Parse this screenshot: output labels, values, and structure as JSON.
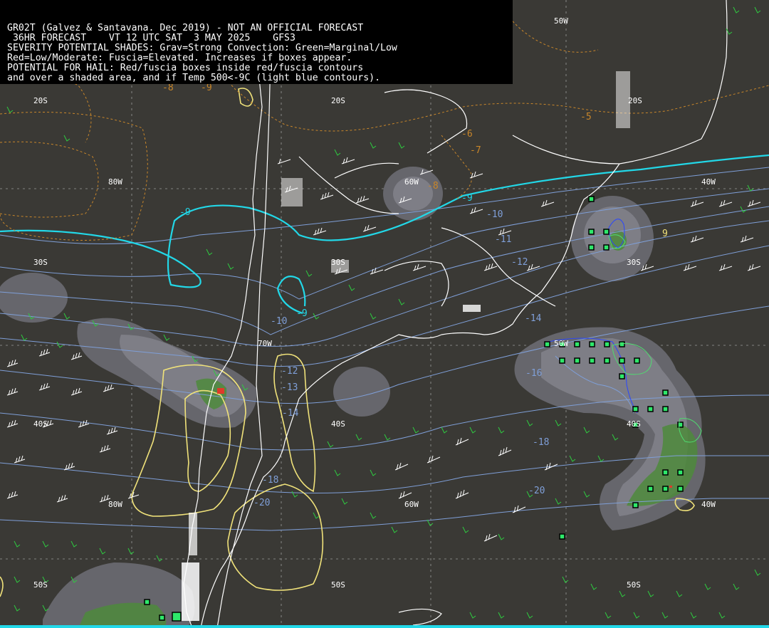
{
  "header": {
    "line1": "GR02T (Galvez & Santavana. Dec 2019) - NOT AN OFFICIAL FORECAST",
    "line2": " 36HR FORECAST    VT 12 UTC SAT  3 MAY 2025    GFS3",
    "line3": "SEVERITY POTENTIAL SHADES: Grav=Strong Convection: Green=Marginal/Low",
    "line4": "Red=Low/Moderate: Fuscia=Elevated. Increases if boxes appear.",
    "line5": "POTENTIAL FOR HAIL: Red/fuscia boxes inside red/fuscia contours",
    "line6": "and over a shaded area, and if Temp 500<-9C (light blue contours)."
  },
  "grid_labels": {
    "lon_50w_top": "50W",
    "lat_20s_a": "20S",
    "lat_20s_b": "20S",
    "lat_20s_c": "20S",
    "lon_80w_a": "80W",
    "lon_60w_a": "60W",
    "lon_40w_a": "40W",
    "lat_30s_a": "30S",
    "lat_30s_b": "30S",
    "lat_30s_c": "30S",
    "lon_70w": "70W",
    "lon_50w_mid": "50W",
    "lat_40s_a": "40S",
    "lat_40s_b": "40S",
    "lat_40s_c": "40S",
    "lon_80w_b": "80W",
    "lon_60w_b": "60W",
    "lon_40w_b": "40W",
    "lat_50s_a": "50S",
    "lat_50s_b": "50S",
    "lat_50s_c": "50S"
  },
  "contour_labels": {
    "temp_m9_a": "-9",
    "temp_m9_b": "-9",
    "temp_m9_c": "-9",
    "temp_m10_a": "-10",
    "temp_m10_b": "-10",
    "temp_m11": "-11",
    "temp_m12_a": "-12",
    "temp_m12_b": "-12",
    "temp_m13": "-13",
    "temp_m14_a": "-14",
    "temp_m14_b": "-14",
    "temp_m16": "-16",
    "temp_m18_a": "-18",
    "temp_m18_b": "-18",
    "temp_m20_a": "-20",
    "temp_m20_b": "-20",
    "orange_m5": "-5",
    "orange_m6": "-6",
    "orange_m7": "-7",
    "orange_m8_a": "-8",
    "orange_m8_b": "-8",
    "orange_m9": "-9",
    "yellow_9": "9"
  },
  "colors": {
    "background": "#3a3935",
    "coastline": "#ffffff",
    "cold_contour": "#22d8e8",
    "temp_contour": "#7f9fd8",
    "orange_dashed": "#c8862a",
    "yellow_contour": "#f0e27a",
    "gray_shade": "#6b6b71",
    "green_shade": "#4e8a3c",
    "box_fill": "#2ee86a",
    "wind_green": "#2ecc40",
    "wind_white": "#ffffff",
    "header_bg": "#000000"
  }
}
